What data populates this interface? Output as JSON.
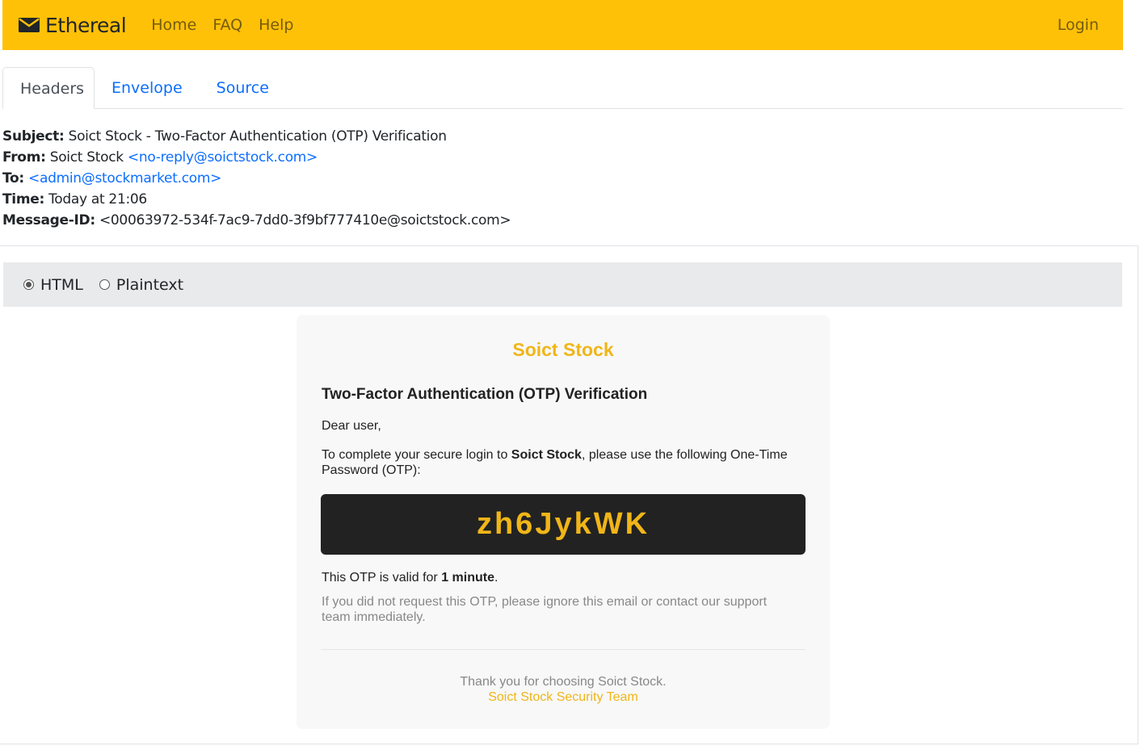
{
  "navbar": {
    "brand": "Ethereal",
    "links": [
      "Home",
      "FAQ",
      "Help"
    ],
    "login": "Login"
  },
  "tabs": [
    "Headers",
    "Envelope",
    "Source"
  ],
  "headers": {
    "subject_label": "Subject:",
    "subject": "Soict Stock - Two-Factor Authentication (OTP) Verification",
    "from_label": "From:",
    "from_name": "Soict Stock",
    "from_email": "<no-reply@soictstock.com>",
    "to_label": "To:",
    "to_email": "<admin@stockmarket.com>",
    "time_label": "Time:",
    "time": "Today at 21:06",
    "message_id_label": "Message-ID:",
    "message_id": "<00063972-534f-7ac9-7dd0-3f9bf777410e@soictstock.com>"
  },
  "view_toggle": {
    "options": [
      "HTML",
      "Plaintext"
    ],
    "selected": "HTML"
  },
  "email": {
    "brand": "Soict Stock",
    "title": "Two-Factor Authentication (OTP) Verification",
    "greeting": "Dear user,",
    "body_pre": "To complete your secure login to ",
    "body_bold": "Soict Stock",
    "body_post": ", please use the following One-Time Password (OTP):",
    "otp": "zh6JykWK",
    "valid_pre": "This OTP is valid for ",
    "valid_bold": "1 minute",
    "valid_post": ".",
    "ignore_note": "If you did not request this OTP, please ignore this email or contact our support team immediately.",
    "thanks": "Thank you for choosing Soict Stock.",
    "team": "Soict Stock Security Team"
  },
  "colors": {
    "navbar_bg": "#ffc107",
    "accent": "#f0b518",
    "link": "#0d6efd",
    "otp_bg": "#222222"
  }
}
